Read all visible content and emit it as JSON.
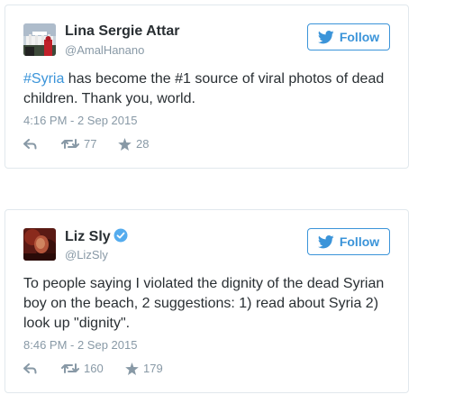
{
  "tweets": [
    {
      "name": "Lina Sergie Attar",
      "handle": "@AmalHanano",
      "verified": false,
      "follow_label": "Follow",
      "text_hashtag": "#Syria",
      "text_rest": " has become the #1 source of viral photos of dead children. Thank you, world.",
      "timestamp": "4:16 PM - 2 Sep 2015",
      "retweets": "77",
      "likes": "28"
    },
    {
      "name": "Liz Sly",
      "handle": "@LizSly",
      "verified": true,
      "follow_label": "Follow",
      "text": "To people saying I violated the dignity of the dead Syrian boy on the beach, 2 suggestions: 1) read about Syria 2) look up \"dignity\".",
      "timestamp": "8:46 PM - 2 Sep 2015",
      "retweets": "160",
      "likes": "179"
    }
  ],
  "icons": {
    "reply": "reply-icon",
    "retweet": "retweet-icon",
    "like": "star-icon",
    "follow": "twitter-bird-icon",
    "verified": "verified-badge-icon"
  },
  "colors": {
    "accent": "#3b94d9",
    "text": "#292f33",
    "muted": "#8899a6",
    "border": "#e1e8ed"
  }
}
